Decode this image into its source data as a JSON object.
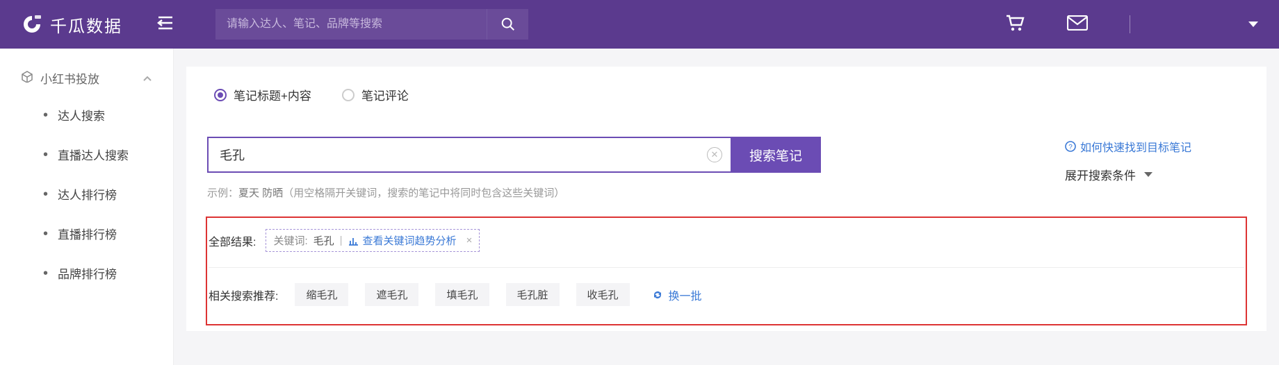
{
  "header": {
    "brand": "千瓜数据",
    "search_placeholder": "请输入达人、笔记、品牌等搜索"
  },
  "sidebar": {
    "group": "小红书投放",
    "items": [
      "达人搜索",
      "直播达人搜索",
      "达人排行榜",
      "直播排行榜",
      "品牌排行榜"
    ]
  },
  "radio": {
    "opt1": "笔记标题+内容",
    "opt2": "笔记评论"
  },
  "search": {
    "value": "毛孔",
    "button": "搜索笔记",
    "hint_prefix": "示例：",
    "hint_example": "夏天 防晒",
    "hint_suffix": "（用空格隔开关键词，搜索的笔记中将同时包含这些关键词）",
    "help": "如何快速找到目标笔记",
    "expand": "展开搜索条件"
  },
  "results": {
    "all_label": "全部结果:",
    "kw_label": "关键词:",
    "kw_value": "毛孔",
    "trend_label": "查看关键词趋势分析",
    "recs_label": "相关搜索推荐:",
    "recs": [
      "缩毛孔",
      "遮毛孔",
      "填毛孔",
      "毛孔脏",
      "收毛孔"
    ],
    "refresh": "换一批"
  }
}
